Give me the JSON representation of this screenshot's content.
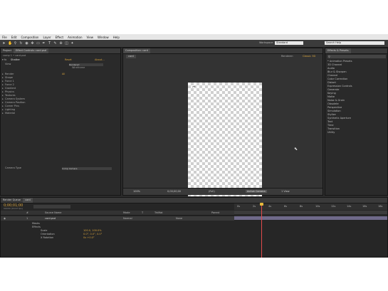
{
  "menubar": {
    "items": [
      "File",
      "Edit",
      "Composition",
      "Layer",
      "Effect",
      "Animation",
      "View",
      "Window",
      "Help"
    ]
  },
  "toolbar": {
    "workspace_label": "Workspace:",
    "workspace_value": "Standard",
    "search_placeholder": "Search Help"
  },
  "left_panel": {
    "tabs": [
      "Project",
      "Effect Controls: card.psd"
    ],
    "breadcrumb": "comp 1 • card.psd",
    "effect_name": "Shatter",
    "reset_label": "Reset",
    "about_label": "About...",
    "view_label": "View",
    "view_value": "Rendered",
    "wireframe_label": "Wireframe",
    "properties": [
      {
        "name": "Render",
        "value": "All"
      },
      {
        "name": "Shape",
        "value": ""
      },
      {
        "name": "Force 1",
        "value": ""
      },
      {
        "name": "Force 2",
        "value": ""
      },
      {
        "name": "Gradient",
        "value": ""
      },
      {
        "name": "Physics",
        "value": ""
      },
      {
        "name": "Textures",
        "value": ""
      },
      {
        "name": "Camera System",
        "value": ""
      },
      {
        "name": "Camera Position",
        "value": ""
      },
      {
        "name": "Corner Pins",
        "value": ""
      },
      {
        "name": "Lighting",
        "value": ""
      },
      {
        "name": "Material",
        "value": ""
      }
    ],
    "extra_label": "Camera Type",
    "extra_value": "Comp Camera"
  },
  "center_panel": {
    "tabs": [
      "Composition: card"
    ],
    "crumb": "card",
    "renderer_label": "Renderer:",
    "renderer_value": "Classic 3D",
    "zoom": "100%",
    "timecode": "0;00;00;00",
    "resolution": "(Full)",
    "camera": "Active Camera",
    "views": "1 View"
  },
  "right_panel": {
    "tabs": [
      "Effects & Presets"
    ],
    "search_value": "",
    "items": [
      "* Animation Presets",
      "3D Channel",
      "Audio",
      "Blur & Sharpen",
      "Channel",
      "Color Correction",
      "Distort",
      "Expression Controls",
      "Generate",
      "Keying",
      "Matte",
      "Noise & Grain",
      "Obsolete",
      "Perspective",
      "Simulation",
      "Stylize",
      "Synthetic Aperture",
      "Text",
      "Time",
      "Transition",
      "Utility"
    ]
  },
  "timeline": {
    "tabs": [
      "Render Queue",
      "card"
    ],
    "timecode": "0;00;01;00",
    "fps": "00030 (29.97 fps)",
    "columns": [
      "#",
      "Source Name",
      "Mode",
      "T",
      "TrkMat",
      "Parent"
    ],
    "layer": {
      "index": "1",
      "name": "card.psd",
      "mode": "Normal",
      "parent": "None"
    },
    "sublines": [
      {
        "name": "Masks",
        "value": ""
      },
      {
        "name": "Effects",
        "value": ""
      },
      {
        "name": "Scale",
        "value": "100.0, 100.0%"
      },
      {
        "name": "Orientation",
        "value": "0.0°, 0.0°, 0.0°"
      },
      {
        "name": "X Rotation",
        "value": "0x +0.0°"
      }
    ],
    "ruler": [
      "0s",
      "2s",
      "4s",
      "6s",
      "8s",
      "10s",
      "12s",
      "14s",
      "16s",
      "18s"
    ]
  },
  "colors": {
    "accent": "#d6a23c",
    "playhead": "#e24a4a",
    "panel": "#2a2a2a"
  }
}
